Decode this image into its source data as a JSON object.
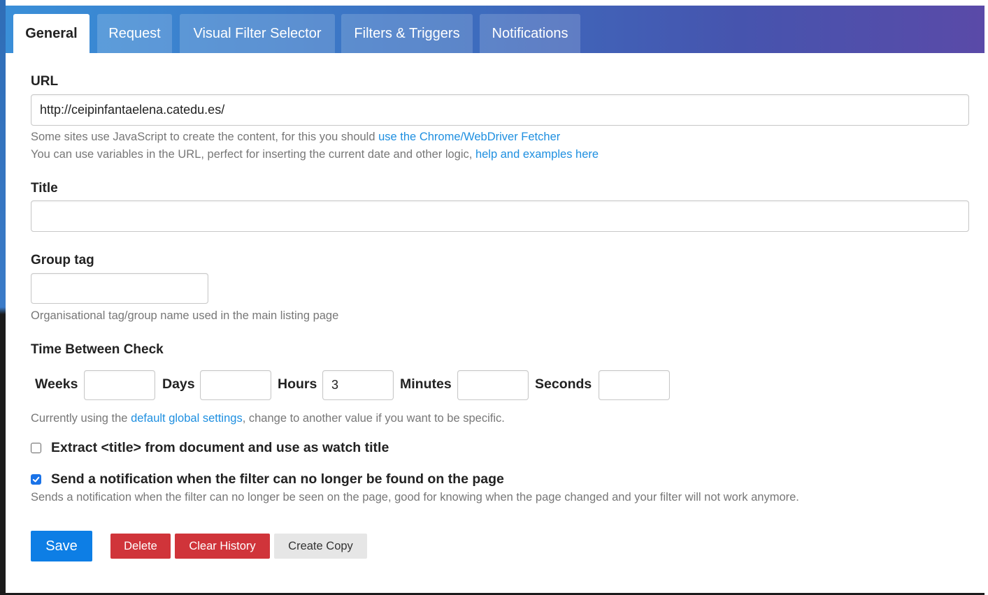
{
  "tabs": [
    {
      "label": "General",
      "active": true
    },
    {
      "label": "Request",
      "active": false
    },
    {
      "label": "Visual Filter Selector",
      "active": false
    },
    {
      "label": "Filters & Triggers",
      "active": false
    },
    {
      "label": "Notifications",
      "active": false
    }
  ],
  "url": {
    "label": "URL",
    "value": "http://ceipinfantaelena.catedu.es/",
    "help1_text": "Some sites use JavaScript to create the content, for this you should ",
    "help1_link": "use the Chrome/WebDriver Fetcher",
    "help2_text": "You can use variables in the URL, perfect for inserting the current date and other logic, ",
    "help2_link": "help and examples here"
  },
  "title": {
    "label": "Title",
    "value": ""
  },
  "group_tag": {
    "label": "Group tag",
    "value": "",
    "help": "Organisational tag/group name used in the main listing page"
  },
  "time_between_check": {
    "label": "Time Between Check",
    "weeks_label": "Weeks",
    "weeks_value": "",
    "days_label": "Days",
    "days_value": "",
    "hours_label": "Hours",
    "hours_value": "3",
    "minutes_label": "Minutes",
    "minutes_value": "",
    "seconds_label": "Seconds",
    "seconds_value": "",
    "help_before": "Currently using the ",
    "help_link": "default global settings",
    "help_after": ", change to another value if you want to be specific."
  },
  "options": {
    "extract_title_label": "Extract <title> from document and use as watch title",
    "extract_title_checked": false,
    "notify_filter_label": "Send a notification when the filter can no longer be found on the page",
    "notify_filter_checked": true,
    "notify_filter_help": "Sends a notification when the filter can no longer be seen on the page, good for knowing when the page changed and your filter will not work anymore."
  },
  "buttons": {
    "save": "Save",
    "delete": "Delete",
    "clear_history": "Clear History",
    "create_copy": "Create Copy"
  },
  "colors": {
    "accent": "#0d7ee5",
    "danger": "#d0343a",
    "link": "#1e8fe0"
  }
}
